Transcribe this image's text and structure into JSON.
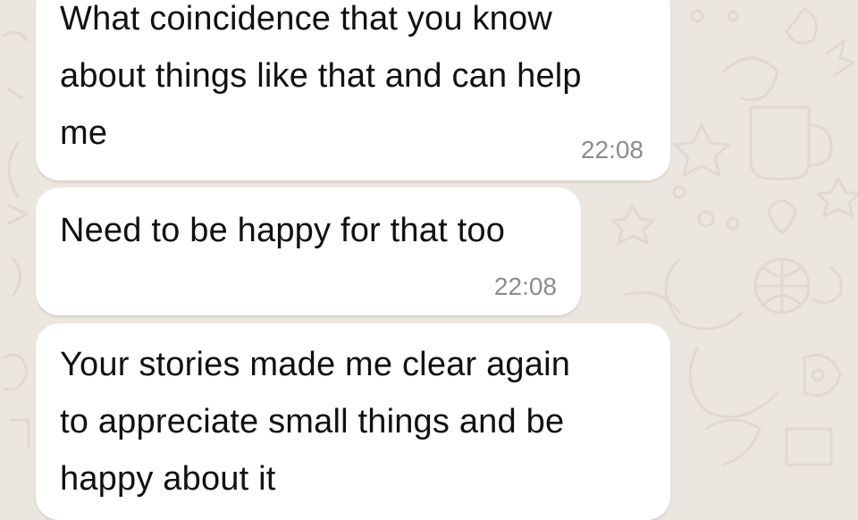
{
  "chat": {
    "messages": [
      {
        "text": "What coincidence that you know\nabout things like that and can help\nme",
        "time": "22:08"
      },
      {
        "text": "Need to be happy for that too",
        "time": "22:08"
      },
      {
        "text": "Your stories made me clear again\nto appreciate small things and be\nhappy about it"
      }
    ]
  },
  "colors": {
    "wallpaper": "#ebe6df",
    "bubble": "#ffffff",
    "text": "#111111",
    "timestamp": "#8c8c8c"
  }
}
